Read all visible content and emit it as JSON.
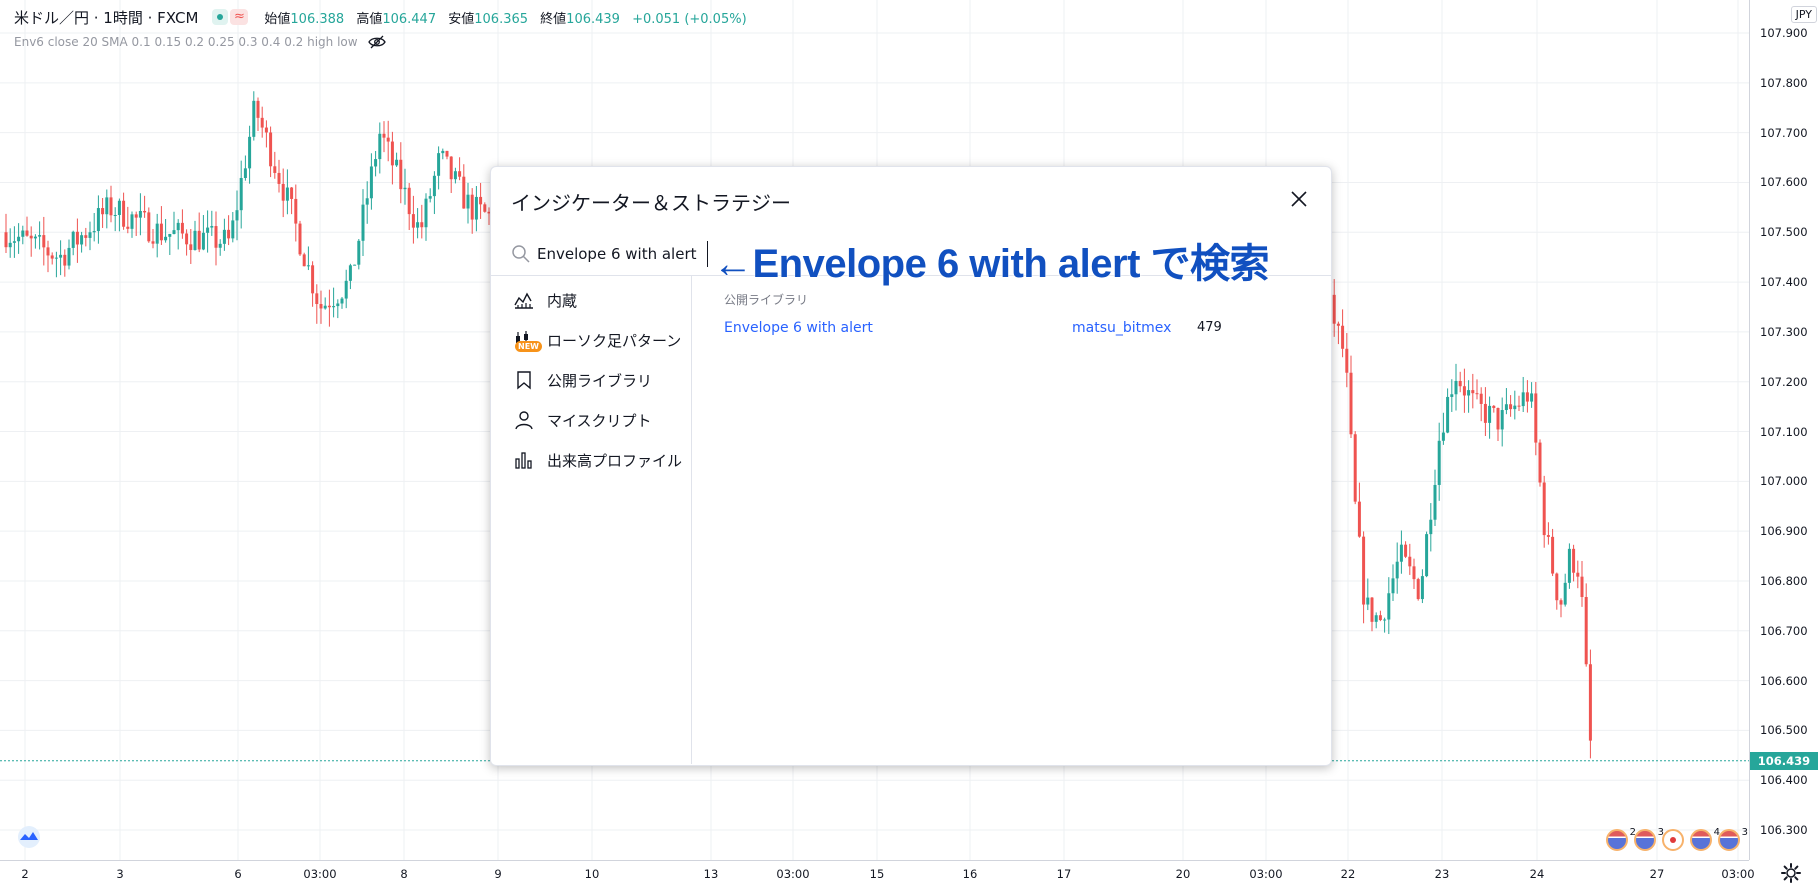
{
  "header": {
    "symbol": "米ドル／円 · 1時間 · FXCM",
    "ohlc": {
      "open_label": "始値",
      "open": "106.388",
      "high_label": "高値",
      "high": "106.447",
      "low_label": "安値",
      "low": "106.365",
      "close_label": "終値",
      "close": "106.439",
      "change": "+0.051 (+0.05%)"
    },
    "indicator": "Env6 close 20 SMA 0.1 0.15 0.2 0.25 0.3 0.4 0.2 high low"
  },
  "price_axis": {
    "currency": "JPY",
    "ticks": [
      "107.900",
      "107.800",
      "107.700",
      "107.600",
      "107.500",
      "107.400",
      "107.300",
      "107.200",
      "107.100",
      "107.000",
      "106.900",
      "106.800",
      "106.700",
      "106.600",
      "106.500",
      "106.400",
      "106.300"
    ],
    "last_price": "106.439"
  },
  "time_axis": {
    "ticks": [
      "2",
      "3",
      "6",
      "03:00",
      "8",
      "9",
      "10",
      "13",
      "03:00",
      "15",
      "16",
      "17",
      "20",
      "03:00",
      "22",
      "23",
      "24",
      "27",
      "03:00"
    ]
  },
  "events": {
    "counts": [
      "2",
      "3",
      "",
      "4",
      "3"
    ]
  },
  "dialog": {
    "title": "インジケーター＆ストラテジー",
    "search": {
      "value": "Envelope 6 with alert",
      "annotation": "←Envelope 6 with alert で検索"
    },
    "sidebar": [
      {
        "label": "内蔵",
        "icon": "built-in-icon"
      },
      {
        "label": "ローソク足パターン",
        "icon": "candlestick-pattern-icon",
        "badge": "NEW"
      },
      {
        "label": "公開ライブラリ",
        "icon": "bookmark-icon"
      },
      {
        "label": "マイスクリプト",
        "icon": "user-icon"
      },
      {
        "label": "出来高プロファイル",
        "icon": "volume-profile-icon"
      }
    ],
    "results": {
      "section_title": "公開ライブラリ",
      "rows": [
        {
          "name": "Envelope 6 with alert",
          "author": "matsu_bitmex",
          "count": "479"
        }
      ]
    }
  },
  "colors": {
    "up": "#26a69a",
    "down": "#ef5350",
    "grid": "#eef0f3",
    "accent": "#2962ff",
    "annotation": "#1150c0"
  }
}
